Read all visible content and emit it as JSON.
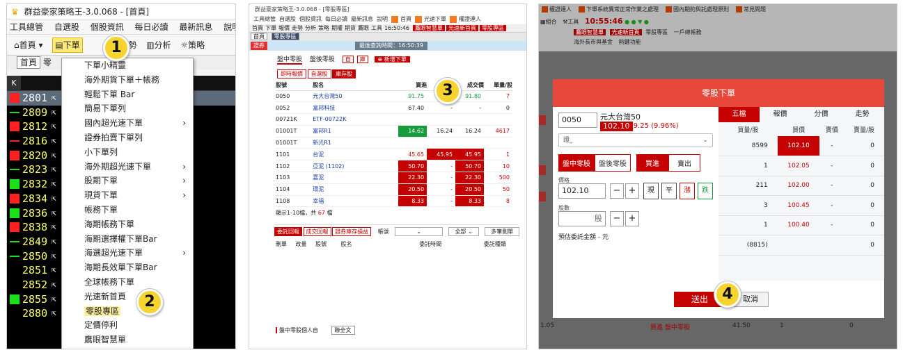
{
  "panel1": {
    "title": "群益豪家策略王-3.0.068 - [首頁]",
    "menu": [
      "工具總管",
      "自選股",
      "個股資訊",
      "每日必讀",
      "最新訊息",
      "說明"
    ],
    "toolbar": [
      {
        "icon": "home-icon",
        "label": "首頁",
        "active": false
      },
      {
        "icon": "order-icon",
        "label": "下單",
        "active": true
      },
      {
        "icon": "trend-icon",
        "label": "走勢",
        "active": false
      },
      {
        "icon": "analysis-icon",
        "label": "分析",
        "active": false
      },
      {
        "icon": "bulb-icon",
        "label": "策略",
        "active": false
      }
    ],
    "tab_home": "首頁",
    "tab_partial": "零",
    "grid_header": "K",
    "rows": [
      {
        "code": "2801",
        "mark": "red",
        "selected": true
      },
      {
        "code": "2809",
        "mark": "gline"
      },
      {
        "code": "2812",
        "mark": "red"
      },
      {
        "code": "2816",
        "mark": "rline"
      },
      {
        "code": "2820",
        "mark": "red"
      },
      {
        "code": "2823",
        "mark": "gline"
      },
      {
        "code": "2832",
        "mark": "green"
      },
      {
        "code": "2834",
        "mark": "red"
      },
      {
        "code": "2836",
        "mark": "green"
      },
      {
        "code": "2838",
        "mark": "red"
      },
      {
        "code": "2849",
        "mark": "gline"
      },
      {
        "code": "2850",
        "mark": "gline"
      },
      {
        "code": "2851",
        "mark": "none"
      },
      {
        "code": "2852",
        "mark": "none"
      },
      {
        "code": "2855",
        "mark": "green"
      },
      {
        "code": "2880",
        "mark": "none"
      }
    ],
    "dropdown": [
      {
        "label": "下單小精靈",
        "sub": false
      },
      {
        "label": "海外期貨下單＋帳務",
        "sub": false
      },
      {
        "label": "輕鬆下單 Bar",
        "sub": false
      },
      {
        "label": "簡易下單列",
        "sub": false
      },
      {
        "label": "國內超光速下單",
        "sub": true
      },
      {
        "label": "證券拍賣下單列",
        "sub": false
      },
      {
        "label": "小下單列",
        "sub": false
      },
      {
        "label": "海外期超光速下單",
        "sub": true
      },
      {
        "label": "股期下單",
        "sub": true
      },
      {
        "label": "現貨下單",
        "sub": true
      },
      {
        "label": "帳務下單",
        "sub": false
      },
      {
        "label": "海期帳務下單",
        "sub": false
      },
      {
        "label": "海期選擇權下單Bar",
        "sub": false
      },
      {
        "label": "海選超光速下單",
        "sub": true
      },
      {
        "label": "海期長效單下單Bar",
        "sub": false
      },
      {
        "label": "全球帳務下單",
        "sub": false
      },
      {
        "label": "光速新首頁",
        "sub": false
      },
      {
        "label": "零股專區",
        "sub": false,
        "highlight": true
      },
      {
        "label": "定價停利",
        "sub": false
      },
      {
        "label": "鷹眼智慧單",
        "sub": false
      }
    ],
    "badge1": "1",
    "badge2": "2"
  },
  "panel2": {
    "title": "群益豪家策略王-3.0.068 - [零股專區]",
    "menu": [
      "工具總管",
      "自選股",
      "個股資訊",
      "每日必讀",
      "最新訊息",
      "說明",
      "首頁",
      "光速下單",
      "權證達人"
    ],
    "qbar": [
      "首頁",
      "下單",
      "報價",
      "走勢",
      "分析",
      "策略",
      "期權",
      "期貨",
      "鷹眼",
      "工具",
      "16:50:46"
    ],
    "qbar_red": [
      "鷹眼智慧單",
      "光速新首頁",
      "零股專區"
    ],
    "tabs": [
      "首頁",
      "零股專區"
    ],
    "acct_label": "證券",
    "last_update": "最後查詢時間：16:50:39",
    "order_tabs": [
      "盤中零股",
      "盤後零股"
    ],
    "tabs_small": [
      "自",
      "庫"
    ],
    "add_button": "新增下單",
    "filters": [
      "即時報價",
      "自選股",
      "庫存股"
    ],
    "table_headers": [
      "股號",
      "股名",
      "買進",
      "賣出",
      "成交價",
      "單量/股"
    ],
    "rows": [
      {
        "code": "0050",
        "name": "元大台灣50",
        "bid": "91.75",
        "ask": "91.80",
        "last": "91.80",
        "vol": "7",
        "style": "g"
      },
      {
        "code": "0052",
        "name": "富邦科技",
        "bid": "67.40",
        "ask": "-",
        "last": "-",
        "vol": "0",
        "style": "n"
      },
      {
        "code": "00721K",
        "name": "ETF-00722K",
        "bid": "",
        "ask": "",
        "last": "",
        "vol": "",
        "style": "b"
      },
      {
        "code": "01001T",
        "name": "富邦R1",
        "bid": "14.62",
        "ask": "16.24",
        "last": "16.24",
        "vol": "4617",
        "style": "gb"
      },
      {
        "code": "01001T",
        "name": "新光R1",
        "bid": "",
        "ask": "",
        "last": "",
        "vol": "",
        "style": "b"
      },
      {
        "code": "1101",
        "name": "台泥",
        "bid": "45.65",
        "ask": "45.95",
        "last": "45.95",
        "vol": "1",
        "style": "r2"
      },
      {
        "code": "1102",
        "name": "亞泥 (1102)",
        "bid": "50.70",
        "ask": "-",
        "last": "50.70",
        "vol": "10",
        "style": "r"
      },
      {
        "code": "1103",
        "name": "嘉泥",
        "bid": "22.30",
        "ask": "-",
        "last": "22.30",
        "vol": "500",
        "style": "r"
      },
      {
        "code": "1104",
        "name": "環泥",
        "bid": "20.50",
        "ask": "-",
        "last": "20.50",
        "vol": "50",
        "style": "r"
      },
      {
        "code": "1108",
        "name": "幸福",
        "bid": "8.33",
        "ask": "-",
        "last": "8.33",
        "vol": "8",
        "style": "r"
      }
    ],
    "count_text": "顯示1-10檔，共",
    "count_num": "67",
    "count_unit": "檔",
    "order_list_tabs": [
      "委託回報",
      "成交回報",
      "證券庫存損益"
    ],
    "acct_select": "帳號",
    "all_select": "全部",
    "batch_button": "多筆刪單",
    "order_headers": [
      "刪單",
      "改量",
      "股號",
      "股名",
      "委託時間",
      "委託種類"
    ],
    "footer_label": "盤中零股個人自",
    "footer_button": "聯全文",
    "badge3": "3"
  },
  "panel3": {
    "menu_items": [
      "權證達人",
      "下單系統異常正常作業之處理",
      "國內期約與託處理原則",
      "常見問題"
    ],
    "tools": [
      "組合",
      "工具",
      "10:55:46"
    ],
    "quick_btns": [
      "鷹眼智慧單",
      "光速新首頁"
    ],
    "zero_zone": "零股專區",
    "one_account": "一戶總帳務",
    "overseas": "海外長市與基金",
    "hotkey": "熱鍵功能",
    "modal_title": "零股下單",
    "code": "0050",
    "stock_name": "元大台灣50",
    "price": "102.10",
    "change": "▲9.25 (9.96%)",
    "account": "證_",
    "session_tabs": [
      "盤中零股",
      "盤後零股"
    ],
    "side_tabs": [
      "買進",
      "賣出"
    ],
    "price_label": "價格",
    "price_value": "102.10",
    "qty_label": "股數",
    "qty_unit": "股",
    "price_types": [
      "現",
      "平",
      "漲",
      "跌"
    ],
    "estimate": "預估委託金額 - 元",
    "right_tabs": [
      "五檔",
      "報價",
      "分價",
      "走勢"
    ],
    "book_headers": [
      "買量/股",
      "買價",
      "賣價",
      "賣量/股"
    ],
    "book": [
      {
        "bq": "8599",
        "bp": "102.10",
        "ap": "-",
        "aq": "0",
        "hl": true
      },
      {
        "bq": "1",
        "bp": "102.05",
        "ap": "-",
        "aq": "0"
      },
      {
        "bq": "211",
        "bp": "102.00",
        "ap": "-",
        "aq": "0"
      },
      {
        "bq": "3",
        "bp": "100.45",
        "ap": "-",
        "aq": "0"
      },
      {
        "bq": "1",
        "bp": "100.40",
        "ap": "-",
        "aq": "0"
      },
      {
        "bq": "(8815)",
        "bp": "",
        "ap": "",
        "aq": "0"
      }
    ],
    "send": "送出",
    "cancel": "取消",
    "bottom_row": {
      "price": "1.05",
      "type": "買進 盤中零股",
      "p2": "41.50",
      "q": "1",
      "z": "0"
    },
    "badge4": "4"
  }
}
